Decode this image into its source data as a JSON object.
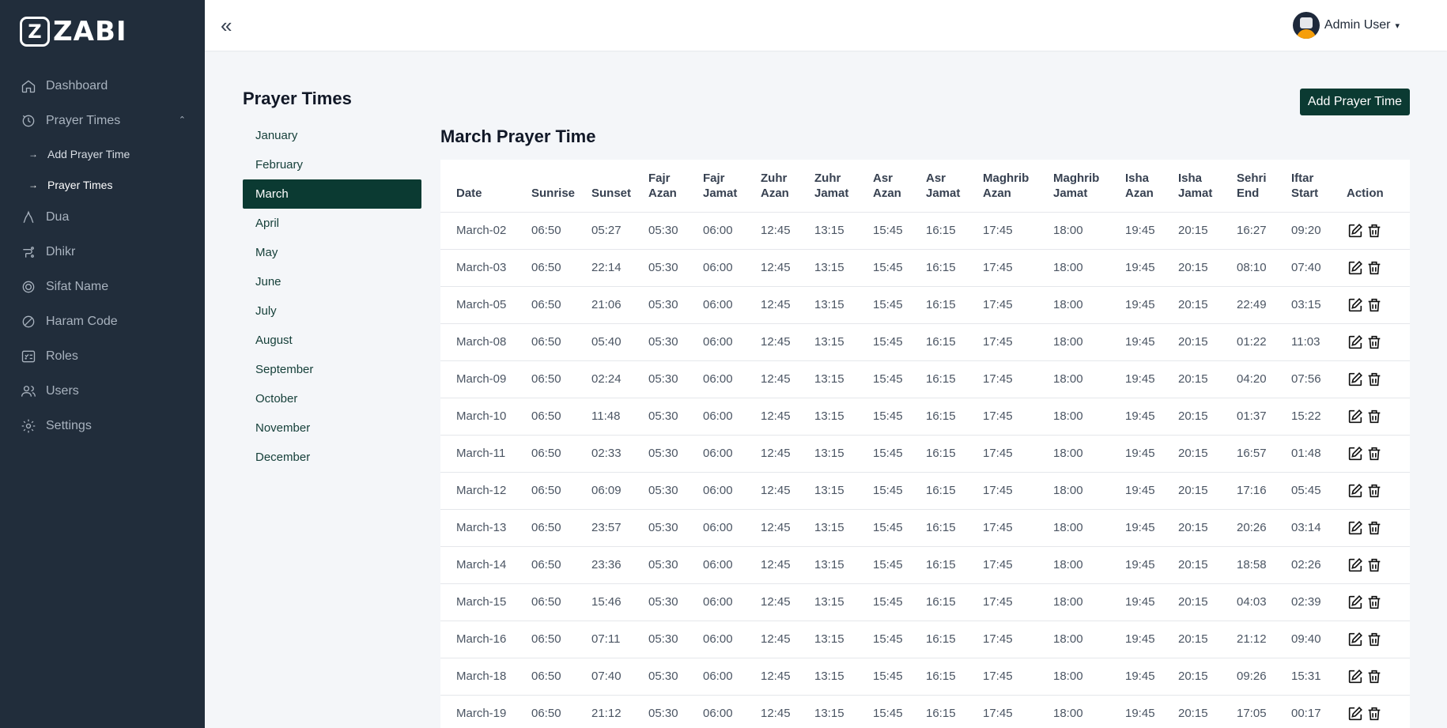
{
  "brand": {
    "logo_letter": "Z",
    "name": "ZABI"
  },
  "sidebar": {
    "items": [
      {
        "label": "Dashboard",
        "icon": "home-icon"
      },
      {
        "label": "Prayer Times",
        "icon": "prayer-icon"
      },
      {
        "label": "Dua",
        "icon": "dua-icon"
      },
      {
        "label": "Dhikr",
        "icon": "dhikr-icon"
      },
      {
        "label": "Sifat Name",
        "icon": "sifat-icon"
      },
      {
        "label": "Haram Code",
        "icon": "ban-icon"
      },
      {
        "label": "Roles",
        "icon": "roles-icon"
      },
      {
        "label": "Users",
        "icon": "users-icon"
      },
      {
        "label": "Settings",
        "icon": "gear-icon"
      }
    ],
    "subitems": [
      {
        "label": "Add Prayer Time"
      },
      {
        "label": "Prayer Times"
      }
    ],
    "arrow": "→"
  },
  "topbar": {
    "collapse_glyph": "«",
    "user_name": "Admin User",
    "user_caret": "▾"
  },
  "page": {
    "title": "Prayer Times",
    "add_button": "Add Prayer Time",
    "section_title": "March Prayer Time"
  },
  "months": [
    "January",
    "February",
    "March",
    "April",
    "May",
    "June",
    "July",
    "August",
    "September",
    "October",
    "November",
    "December"
  ],
  "selected_month": "March",
  "table": {
    "headers": [
      [
        "Date"
      ],
      [
        "Sunrise"
      ],
      [
        "Sunset"
      ],
      [
        "Fajr",
        "Azan"
      ],
      [
        "Fajr",
        "Jamat"
      ],
      [
        "Zuhr",
        "Azan"
      ],
      [
        "Zuhr",
        "Jamat"
      ],
      [
        "Asr",
        "Azan"
      ],
      [
        "Asr",
        "Jamat"
      ],
      [
        "Maghrib",
        "Azan"
      ],
      [
        "Maghrib",
        "Jamat"
      ],
      [
        "Isha",
        "Azan"
      ],
      [
        "Isha",
        "Jamat"
      ],
      [
        "Sehri",
        "End"
      ],
      [
        "Iftar",
        "Start"
      ],
      [
        "Action"
      ]
    ],
    "rows": [
      [
        "March-02",
        "06:50",
        "05:27",
        "05:30",
        "06:00",
        "12:45",
        "13:15",
        "15:45",
        "16:15",
        "17:45",
        "18:00",
        "19:45",
        "20:15",
        "16:27",
        "09:20"
      ],
      [
        "March-03",
        "06:50",
        "22:14",
        "05:30",
        "06:00",
        "12:45",
        "13:15",
        "15:45",
        "16:15",
        "17:45",
        "18:00",
        "19:45",
        "20:15",
        "08:10",
        "07:40"
      ],
      [
        "March-05",
        "06:50",
        "21:06",
        "05:30",
        "06:00",
        "12:45",
        "13:15",
        "15:45",
        "16:15",
        "17:45",
        "18:00",
        "19:45",
        "20:15",
        "22:49",
        "03:15"
      ],
      [
        "March-08",
        "06:50",
        "05:40",
        "05:30",
        "06:00",
        "12:45",
        "13:15",
        "15:45",
        "16:15",
        "17:45",
        "18:00",
        "19:45",
        "20:15",
        "01:22",
        "11:03"
      ],
      [
        "March-09",
        "06:50",
        "02:24",
        "05:30",
        "06:00",
        "12:45",
        "13:15",
        "15:45",
        "16:15",
        "17:45",
        "18:00",
        "19:45",
        "20:15",
        "04:20",
        "07:56"
      ],
      [
        "March-10",
        "06:50",
        "11:48",
        "05:30",
        "06:00",
        "12:45",
        "13:15",
        "15:45",
        "16:15",
        "17:45",
        "18:00",
        "19:45",
        "20:15",
        "01:37",
        "15:22"
      ],
      [
        "March-11",
        "06:50",
        "02:33",
        "05:30",
        "06:00",
        "12:45",
        "13:15",
        "15:45",
        "16:15",
        "17:45",
        "18:00",
        "19:45",
        "20:15",
        "16:57",
        "01:48"
      ],
      [
        "March-12",
        "06:50",
        "06:09",
        "05:30",
        "06:00",
        "12:45",
        "13:15",
        "15:45",
        "16:15",
        "17:45",
        "18:00",
        "19:45",
        "20:15",
        "17:16",
        "05:45"
      ],
      [
        "March-13",
        "06:50",
        "23:57",
        "05:30",
        "06:00",
        "12:45",
        "13:15",
        "15:45",
        "16:15",
        "17:45",
        "18:00",
        "19:45",
        "20:15",
        "20:26",
        "03:14"
      ],
      [
        "March-14",
        "06:50",
        "23:36",
        "05:30",
        "06:00",
        "12:45",
        "13:15",
        "15:45",
        "16:15",
        "17:45",
        "18:00",
        "19:45",
        "20:15",
        "18:58",
        "02:26"
      ],
      [
        "March-15",
        "06:50",
        "15:46",
        "05:30",
        "06:00",
        "12:45",
        "13:15",
        "15:45",
        "16:15",
        "17:45",
        "18:00",
        "19:45",
        "20:15",
        "04:03",
        "02:39"
      ],
      [
        "March-16",
        "06:50",
        "07:11",
        "05:30",
        "06:00",
        "12:45",
        "13:15",
        "15:45",
        "16:15",
        "17:45",
        "18:00",
        "19:45",
        "20:15",
        "21:12",
        "09:40"
      ],
      [
        "March-18",
        "06:50",
        "07:40",
        "05:30",
        "06:00",
        "12:45",
        "13:15",
        "15:45",
        "16:15",
        "17:45",
        "18:00",
        "19:45",
        "20:15",
        "09:26",
        "15:31"
      ],
      [
        "March-19",
        "06:50",
        "21:12",
        "05:30",
        "06:00",
        "12:45",
        "13:15",
        "15:45",
        "16:15",
        "17:45",
        "18:00",
        "19:45",
        "20:15",
        "17:05",
        "00:17"
      ]
    ]
  },
  "colors": {
    "sidebar_bg": "#212d3b",
    "accent": "#0b3a32",
    "page_bg": "#f4f6f9"
  }
}
